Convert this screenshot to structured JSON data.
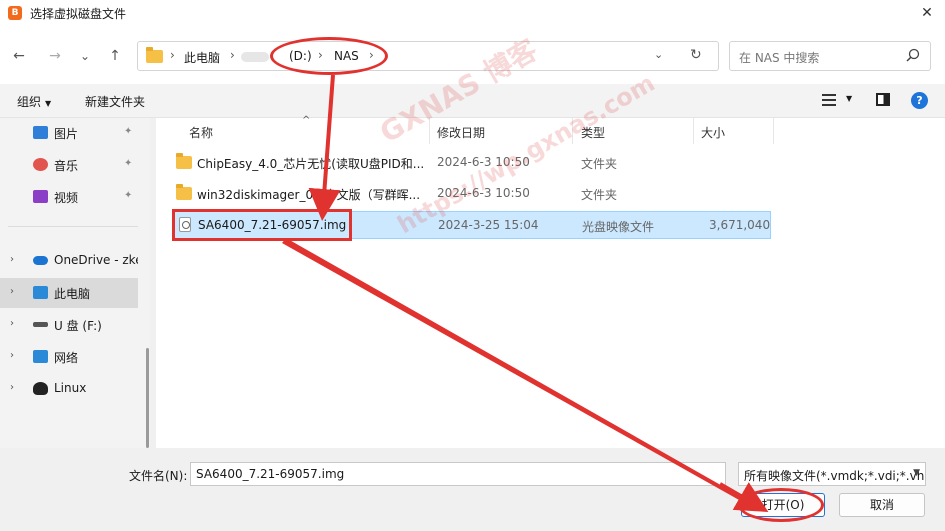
{
  "window": {
    "app_icon_glyph": "B",
    "title": "选择虚拟磁盘文件",
    "close_glyph": "✕"
  },
  "nav": {
    "back_glyph": "←",
    "forward_glyph": "→",
    "recent_glyph": "⌄",
    "up_glyph": "↑"
  },
  "address": {
    "crumbs": [
      "此电脑",
      "(D:)",
      "NAS"
    ],
    "separator": "›",
    "dropdown_glyph": "⌄",
    "refresh_glyph": "↻"
  },
  "search": {
    "placeholder": "在 NAS 中搜索"
  },
  "toolbar": {
    "organize_label": "组织",
    "new_folder_label": "新建文件夹",
    "caret_glyph": "▼",
    "help_glyph": "?"
  },
  "sidebar": {
    "items": [
      {
        "label": "图片",
        "icon": "pictures-icon",
        "color": "#2f7fd8",
        "pinned": true
      },
      {
        "label": "音乐",
        "icon": "music-icon",
        "color": "#e2554f",
        "pinned": true
      },
      {
        "label": "视频",
        "icon": "videos-icon",
        "color": "#8a3fc6",
        "pinned": true
      },
      {
        "label": "OneDrive - zke",
        "icon": "onedrive-icon",
        "color": "#1c74d2",
        "expandable": true
      },
      {
        "label": "此电脑",
        "icon": "this-pc-icon",
        "color": "#2a8ad8",
        "expandable": true,
        "selected": true
      },
      {
        "label": "U 盘 (F:)",
        "icon": "usb-drive-icon",
        "color": "#555555",
        "expandable": true
      },
      {
        "label": "网络",
        "icon": "network-icon",
        "color": "#2a8ad8",
        "expandable": true
      },
      {
        "label": "Linux",
        "icon": "linux-icon",
        "color": "#222222",
        "expandable": true
      }
    ],
    "pin_glyph": "📌",
    "chevron_glyph": "›"
  },
  "filelist": {
    "columns": [
      "名称",
      "修改日期",
      "类型",
      "大小"
    ],
    "sort_glyph": "^",
    "rows": [
      {
        "name": "ChipEasy_4.0_芯片无忧(读取U盘PID和...",
        "date": "2024-6-3 10:50",
        "type": "文件夹",
        "size": "",
        "icon": "folder-icon"
      },
      {
        "name": "win32diskimager_0.9中文版（写群晖...",
        "date": "2024-6-3 10:50",
        "type": "文件夹",
        "size": "",
        "icon": "folder-icon"
      },
      {
        "name": "SA6400_7.21-69057.img",
        "date": "2024-3-25 15:04",
        "type": "光盘映像文件",
        "size": "3,671,040...",
        "icon": "disc-image-icon",
        "selected": true
      }
    ]
  },
  "footer": {
    "filename_label": "文件名(N):",
    "filename_value": "SA6400_7.21-69057.img",
    "filter_value": "所有映像文件(*.vmdk;*.vdi;*.vh",
    "open_label": "打开(O)",
    "cancel_label": "取消"
  },
  "watermark": {
    "line1": "GXNAS 博客",
    "line2": "https://wp.gxnas.com"
  },
  "annotation_color": "#e0322f"
}
